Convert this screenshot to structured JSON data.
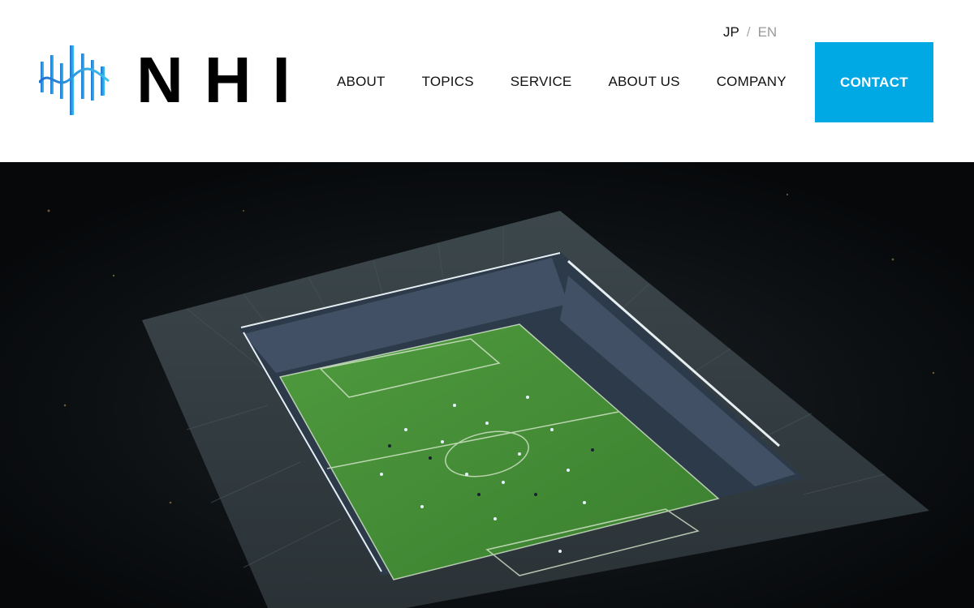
{
  "brand": {
    "name": "NHI",
    "mark_icon": "nhi-wave-logo-icon",
    "accent_color": "#00a8e4",
    "logo_gradient": [
      "#1e6fd0",
      "#3fc3ee"
    ]
  },
  "language": {
    "active": "JP",
    "separator": "/",
    "inactive": "EN"
  },
  "nav": {
    "items": [
      {
        "label": "ABOUT"
      },
      {
        "label": "TOPICS"
      },
      {
        "label": "SERVICE"
      },
      {
        "label": "ABOUT US"
      },
      {
        "label": "COMPANY"
      }
    ],
    "contact_label": "CONTACT"
  },
  "hero": {
    "image": "night-aerial-football-stadium",
    "pitch_color": "#3f8a34",
    "background_color": "#07090b"
  }
}
